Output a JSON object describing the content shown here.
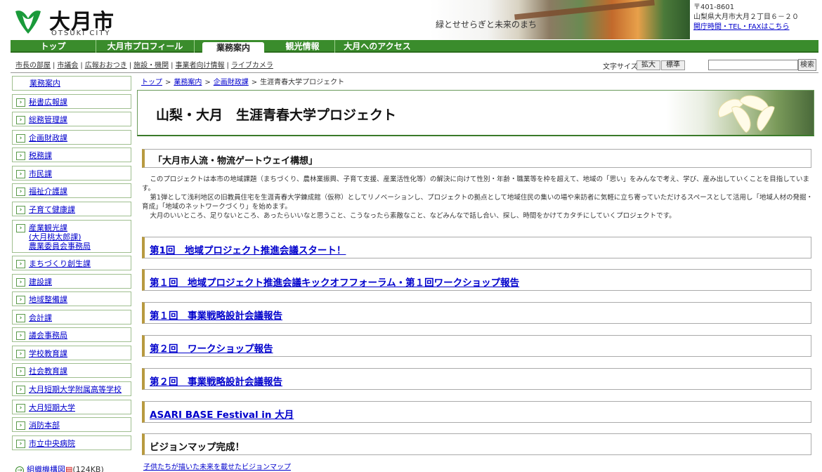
{
  "header": {
    "logo_name": "大月市",
    "logo_sub": "OTSUKI CITY",
    "slogan": "緑とせせらぎと未来のまち",
    "postal": "〒401-8601",
    "address": "山梨県大月市大月２丁目６－２０",
    "hours_link": "開庁時間・TEL・FAXはこちら"
  },
  "gnav": [
    {
      "label": "トップ"
    },
    {
      "label": "大月市プロフィール"
    },
    {
      "label": "業務案内"
    },
    {
      "label": "観光情報"
    },
    {
      "label": "大月へのアクセス"
    }
  ],
  "subnav": [
    "市長の部屋",
    "市議会",
    "広報おおつき",
    "施設・機関",
    "事業者向け情報",
    "ライブカメラ"
  ],
  "fontsize": {
    "label": "文字サイズ",
    "enlarge": "拡大",
    "standard": "標準"
  },
  "search": {
    "button": "検索",
    "placeholder": ""
  },
  "sidebar": {
    "head": "業務案内",
    "items": [
      "秘書広報課",
      "総務管理課",
      "企画財政課",
      "税務課",
      "市民課",
      "福祉介護課",
      "子育て健康課",
      "産業観光課",
      "(大月桃太郎課)",
      "農業委員会事務局",
      "まちづくり創生課",
      "建設課",
      "地域整備課",
      "会計課",
      "議会事務局",
      "学校教育課",
      "社会教育課",
      "大月短期大学附属高等学校",
      "大月短期大学",
      "消防本部",
      "市立中央病院"
    ],
    "org_chart": "組織機構図",
    "org_size": "(124KB)"
  },
  "breadcrumb": [
    "トップ",
    "業務案内",
    "企画財政課",
    "生涯青春大学プロジェクト"
  ],
  "main": {
    "title": "山梨・大月　生涯青春大学プロジェクト",
    "section_title": "「大月市人流・物流ゲートウェイ構想」",
    "intro": [
      "このプロジェクトは本市の地域課題（まちづくり、農林業振興、子育て支援、産業活性化等）の解決に向けて性別・年齢・職業等を枠を超えて、地域の「思い」をみんなで考え、学び、産み出していくことを目指しています。",
      "第1弾として浅利地区の旧教員住宅を生涯青春大学錬成館（仮称）としてリノベーションし、プロジェクトの拠点として地域住民の集いの場や来訪者に気軽に立ち寄っていただけるスペースとして活用し「地域人材の発掘・育成」「地域のネットワークづくり」を始めます。",
      "大月のいいところ、足りないところ、あったらいいなと思うこと、こうなったら素敵なこと、などみんなで話し合い、探し、時間をかけてカタチにしていくプロジェクトです。"
    ],
    "links": [
      "第1回　地域プロジェクト推進会議スタート！",
      "第１回　地域プロジェクト推進会議キックオフフォーラム・第１回ワークショップ報告",
      "第１回　事業戦略設計会議報告",
      "第２回　ワークショップ報告",
      "第２回　事業戦略設計会議報告",
      "ASARI BASE Festival in 大月"
    ],
    "vision_title": "ビジョンマップ完成！",
    "vision_note": "子供たちが描いた未来を載せたビジョンマップ"
  }
}
